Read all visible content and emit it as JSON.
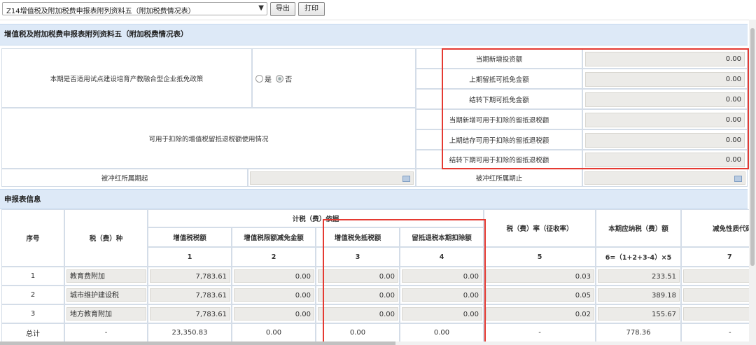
{
  "toolbar": {
    "form_select": "Z14增值税及附加税费申报表附列资料五（附加税费情况表）",
    "export_label": "导出",
    "print_label": "打印"
  },
  "section1": {
    "title": "增值税及附加税费申报表附列资料五（附加税费情况表）",
    "policy_question": "本期是否适用试点建设培育产教融合型企业抵免政策",
    "option_yes": "是",
    "option_no": "否",
    "selected": "否",
    "fields": [
      {
        "label": "当期新增投资额",
        "value": "0.00"
      },
      {
        "label": "上期留抵可抵免金额",
        "value": "0.00"
      },
      {
        "label": "结转下期可抵免金额",
        "value": "0.00"
      },
      {
        "label": "当期新增可用于扣除的留抵退税额",
        "value": "0.00"
      },
      {
        "label": "上期结存可用于扣除的留抵退税额",
        "value": "0.00"
      },
      {
        "label": "结转下期可用于扣除的留抵退税额",
        "value": "0.00"
      }
    ],
    "retention_label": "可用于扣除的增值税留抵退税额使用情况",
    "period_start_label": "被冲红所属期起",
    "period_end_label": "被冲红所属期止"
  },
  "section2": {
    "title": "申报表信息",
    "headers": {
      "seq": "序号",
      "tax_type": "税（费）种",
      "basis_group": "计税（费）依据",
      "vat_amount": "增值税税额",
      "vat_limit_reduction": "增值税限额减免金额",
      "vat_exempt_offset": "增值税免抵税额",
      "retention_deduction": "留抵退税本期扣除额",
      "rate": "税（费）率（征收率）",
      "payable": "本期应纳税（费）额",
      "reduction_code": "减免性质代码"
    },
    "col_numbers": {
      "c1": "1",
      "c2": "2",
      "c3": "3",
      "c4": "4",
      "c5": "5",
      "c6": "6=（1+2+3-4）×5",
      "c7": "7"
    },
    "rows": [
      {
        "seq": "1",
        "name": "教育费附加",
        "vat": "7,783.61",
        "limit": "0.00",
        "exempt": "0.00",
        "retention": "0.00",
        "rate": "0.03",
        "payable": "233.51"
      },
      {
        "seq": "2",
        "name": "城市维护建设税",
        "vat": "7,783.61",
        "limit": "0.00",
        "exempt": "0.00",
        "retention": "0.00",
        "rate": "0.05",
        "payable": "389.18"
      },
      {
        "seq": "3",
        "name": "地方教育附加",
        "vat": "7,783.61",
        "limit": "0.00",
        "exempt": "0.00",
        "retention": "0.00",
        "rate": "0.02",
        "payable": "155.67"
      }
    ],
    "total": {
      "seq": "总计",
      "name": "-",
      "vat": "23,350.83",
      "limit": "0.00",
      "exempt": "0.00",
      "retention": "0.00",
      "rate": "-",
      "payable": "778.36",
      "code": "-"
    }
  },
  "colors": {
    "highlight_box": "#e53a32",
    "section_bg": "#dde9f7"
  }
}
